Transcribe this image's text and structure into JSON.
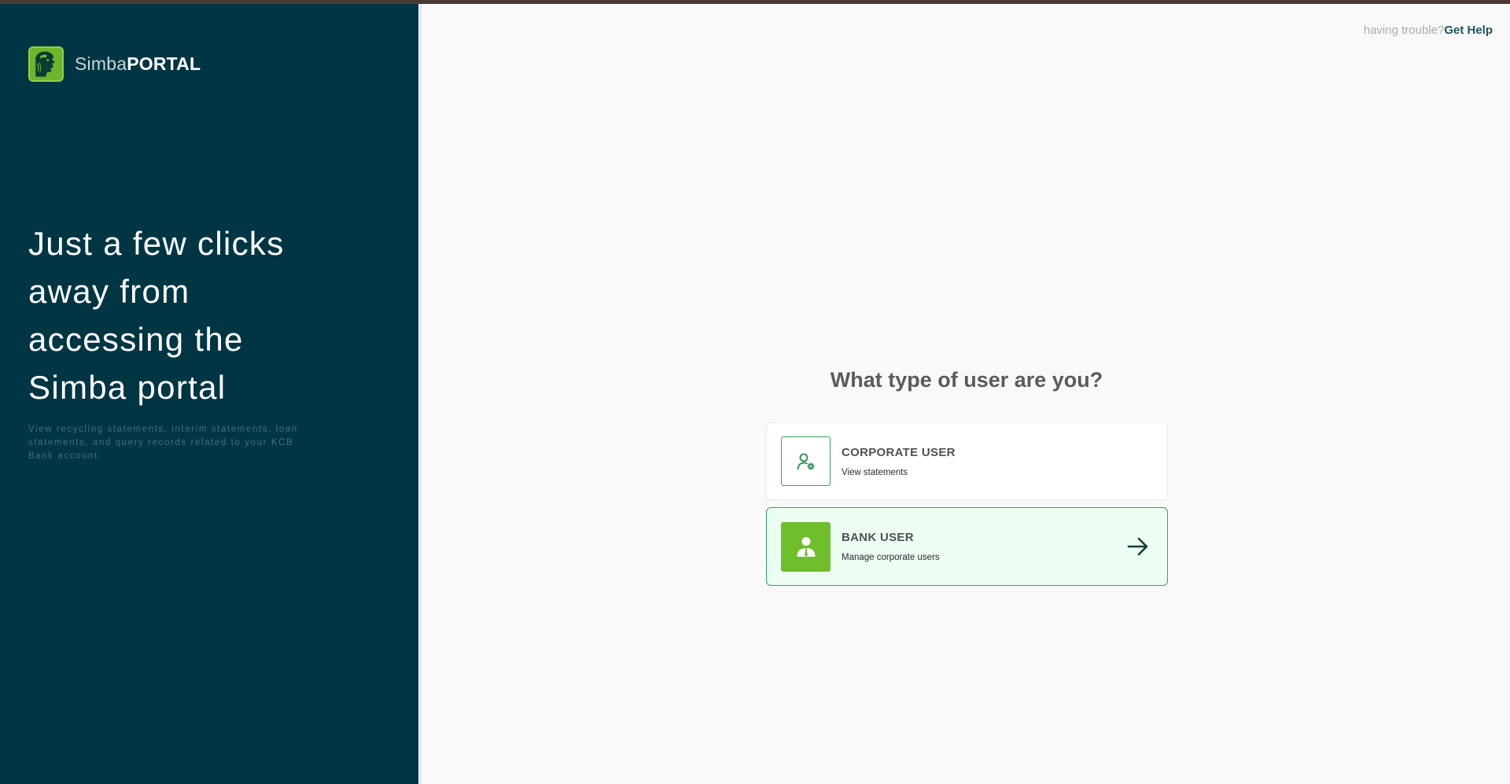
{
  "brand": {
    "name_light": "Simba",
    "name_bold": "PORTAL",
    "logo_icon": "lion-logo-icon"
  },
  "hero": {
    "headline": "Just a few clicks away from accessing the Simba portal",
    "subtext": "View recycling statements, interim statements, loan statements, and query records related to your KCB Bank account"
  },
  "help": {
    "prompt": "having trouble?",
    "link_label": "Get Help"
  },
  "main": {
    "question": "What type of user are you?",
    "options": [
      {
        "title": "CORPORATE USER",
        "description": "View statements",
        "icon": "user-gear-icon",
        "selected": false
      },
      {
        "title": "BANK USER",
        "description": "Manage corporate users",
        "icon": "user-tie-icon",
        "selected": true
      }
    ]
  },
  "colors": {
    "sidebar": "#003644",
    "accent_green": "#6fbe2b",
    "border_green": "#3aa35d",
    "selected_bg": "#ecfdf2",
    "top_bar": "#4a3935"
  }
}
